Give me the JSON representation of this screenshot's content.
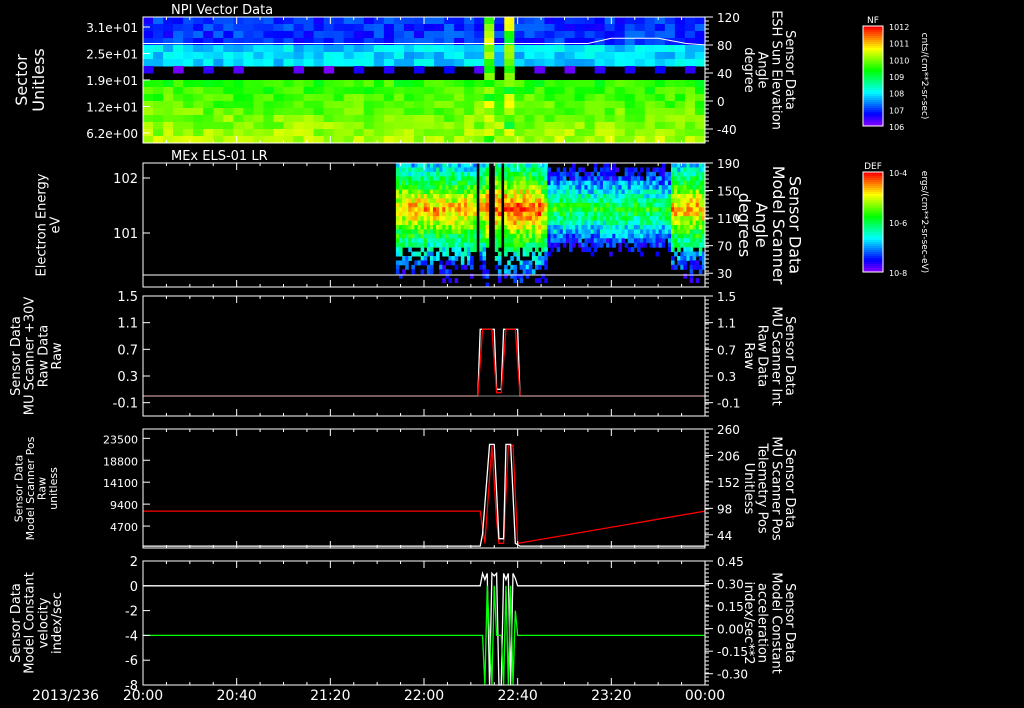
{
  "date_label": "2013/236",
  "time_axis": {
    "start_min": 0,
    "end_min": 240,
    "ticks": [
      "20:00",
      "20:40",
      "21:20",
      "22:00",
      "22:40",
      "23:20",
      "00:00"
    ]
  },
  "chart_data": [
    {
      "type": "heatmap",
      "title": "NPI Vector Data",
      "ylabel": [
        "Sector",
        "Unitless"
      ],
      "yticks": [
        "3.1e+01",
        "2.5e+01",
        "1.9e+01",
        "1.2e+01",
        "6.2e+00"
      ],
      "right_label": [
        "Sensor Data",
        "ESH Sun Elevation",
        "Angle",
        "degree"
      ],
      "right_ticks": [
        "120",
        "80",
        "40",
        "0",
        "-40"
      ],
      "right_range": [
        -70,
        120
      ],
      "overlay_line": {
        "color": "#ffffff",
        "value_deg": 80,
        "late_value_deg": 88
      },
      "colorbar": {
        "label": "NF",
        "ticks": [
          "10^12",
          "10^11",
          "10^10",
          "10^9",
          "10^8",
          "10^7",
          "10^6"
        ],
        "units": "cnts/(cm**2-sr-sec)"
      }
    },
    {
      "type": "heatmap",
      "title": "MEx ELS-01 LR",
      "ylabel": [
        "Electron Energy",
        "eV"
      ],
      "yticks": [
        "10^2",
        "10^1"
      ],
      "right_label": [
        "Sensor Data",
        "Model Scanner",
        "Angle",
        "degrees"
      ],
      "right_ticks": [
        "190",
        "150",
        "110",
        "70",
        "30"
      ],
      "data_start_min": 108,
      "colorbar": {
        "label": "DEF",
        "ticks": [
          "10^-4",
          "10^-6",
          "10^-8"
        ],
        "units": "ergs/(cm**2-sr-sec-eV)"
      }
    },
    {
      "type": "line",
      "ylabel": [
        "Sensor Data",
        "MU Scanner +30V",
        "Raw Data",
        "Raw"
      ],
      "yticks": [
        "1.5",
        "1.1",
        "0.7",
        "0.3",
        "-0.1"
      ],
      "ylim": [
        -0.3,
        1.5
      ],
      "right_label": [
        "Sensor Data",
        "MU Scanner Int",
        "Raw Data",
        "Raw"
      ],
      "right_ticks": [
        "1.5",
        "1.1",
        "0.7",
        "0.3",
        "-0.1"
      ],
      "series": [
        {
          "name": "+30V",
          "color": "#ffffff",
          "x": [
            0,
            143,
            144,
            150,
            151,
            153,
            154,
            160,
            161,
            240
          ],
          "y": [
            0,
            0,
            1,
            1,
            0.1,
            0.1,
            1,
            1,
            0,
            0
          ]
        },
        {
          "name": "Int",
          "color": "#ff0000",
          "x": [
            0,
            143,
            145,
            149,
            151,
            153,
            155,
            159,
            161,
            240
          ],
          "y": [
            0,
            0,
            1,
            1,
            0.05,
            0.05,
            1,
            1,
            0,
            0
          ]
        }
      ]
    },
    {
      "type": "line",
      "ylabel": [
        "Sensor Data",
        "Model Scanner Pos",
        "Raw",
        "unitless"
      ],
      "yticks": [
        "23500",
        "18800",
        "14100",
        "9400",
        "4700"
      ],
      "ylim": [
        0,
        25500
      ],
      "right_label": [
        "Sensor Data",
        "MU Scanner Pos",
        "Telemetry Pos",
        "Unitless"
      ],
      "right_ticks": [
        "260",
        "206",
        "152",
        "98",
        "44"
      ],
      "series": [
        {
          "name": "Telemetry",
          "color": "#ff0000",
          "x": [
            0,
            144,
            146,
            149,
            151,
            152,
            154,
            156,
            158,
            160,
            240
          ],
          "y": [
            7900,
            7900,
            1000,
            22000,
            6000,
            1000,
            1000,
            22000,
            22000,
            1000,
            7900
          ]
        },
        {
          "name": "Model",
          "color": "#ffffff",
          "x": [
            0,
            144,
            145,
            148,
            150,
            152,
            154,
            155,
            157,
            159,
            161,
            240
          ],
          "y": [
            400,
            400,
            3000,
            22200,
            22200,
            2000,
            2000,
            22200,
            22200,
            1000,
            400,
            400
          ]
        }
      ]
    },
    {
      "type": "line",
      "ylabel": [
        "Sensor Data",
        "Model Constant",
        "velocity",
        "index/sec"
      ],
      "yticks": [
        "2",
        "0",
        "-2",
        "-4",
        "-6",
        "-8"
      ],
      "ylim": [
        -8,
        2
      ],
      "right_label": [
        "Sensor Data",
        "Model Constant",
        "acceleration",
        "index/sec**2"
      ],
      "right_ticks": [
        "0.45",
        "0.30",
        "0.15",
        "0.00",
        "-0.15",
        "-0.30"
      ],
      "series": [
        {
          "name": "velocity",
          "color": "#ffffff",
          "x": [
            0,
            144,
            145,
            146,
            147,
            148,
            149,
            150,
            151,
            152,
            153,
            154,
            155,
            156,
            157,
            158,
            159,
            160,
            240
          ],
          "y": [
            0,
            0,
            1,
            0.5,
            1,
            -8,
            1,
            0.8,
            1,
            -8,
            -8,
            1,
            0.5,
            1,
            -8,
            1,
            0.6,
            0,
            0
          ]
        },
        {
          "name": "acceleration",
          "color": "#00ff00",
          "x": [
            0,
            145,
            146,
            147,
            148,
            149,
            150,
            151,
            153,
            154,
            155,
            156,
            157,
            158,
            159,
            160,
            240
          ],
          "y": [
            -4,
            -4,
            -8,
            0,
            -4,
            -8,
            0,
            -4,
            -4,
            -8,
            0,
            -8,
            0,
            -8,
            -2,
            -4,
            -4
          ]
        }
      ]
    }
  ]
}
